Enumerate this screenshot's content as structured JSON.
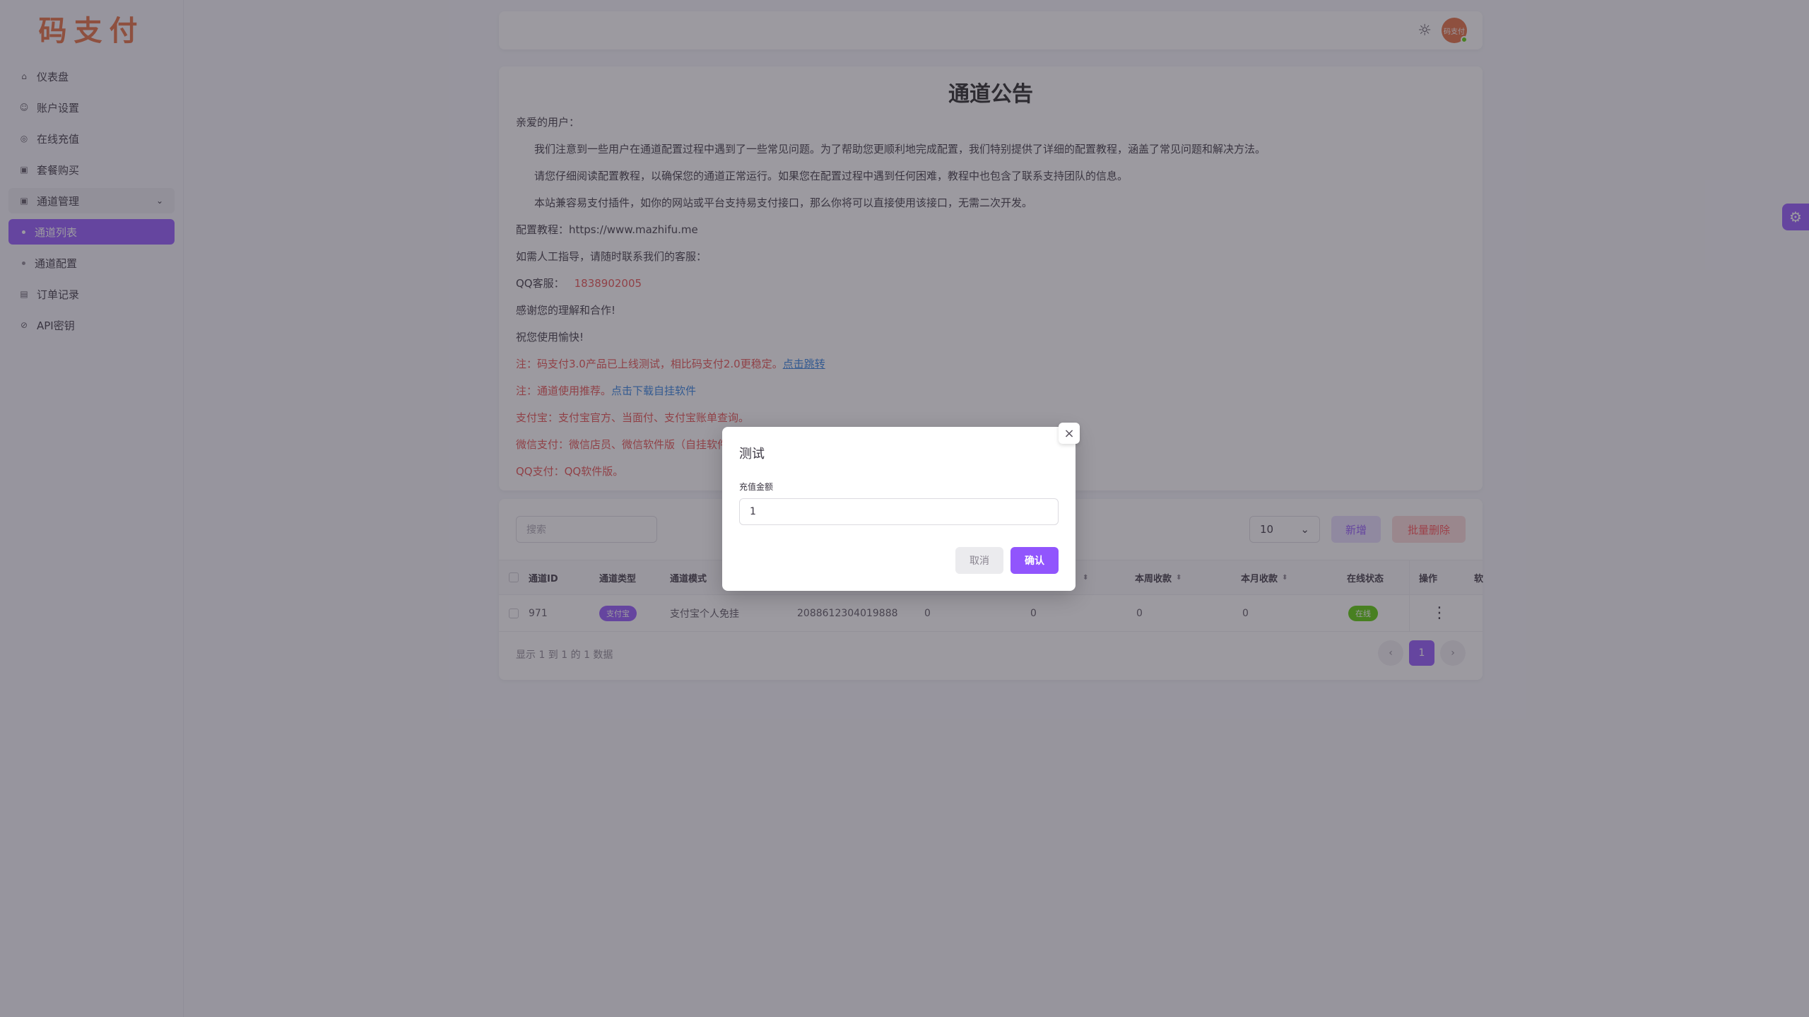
{
  "brand": {
    "logo": "码支付",
    "accent": "#9155fd",
    "logo_color": "#e26a3c"
  },
  "sidebar": {
    "items": [
      {
        "label": "仪表盘",
        "icon": "home-icon"
      },
      {
        "label": "账户设置",
        "icon": "user-icon"
      },
      {
        "label": "在线充值",
        "icon": "coin-icon"
      },
      {
        "label": "套餐购买",
        "icon": "package-icon"
      },
      {
        "label": "通道管理",
        "icon": "channel-icon",
        "expanded": true
      },
      {
        "label": "通道列表",
        "sub": true,
        "active": true
      },
      {
        "label": "通道配置",
        "sub": true
      },
      {
        "label": "订单记录",
        "icon": "order-icon"
      },
      {
        "label": "API密钥",
        "icon": "key-icon"
      }
    ]
  },
  "topbar": {
    "avatar_text": "码支付"
  },
  "notice": {
    "title": "通道公告",
    "greeting": "亲爱的用户：",
    "p1": "我们注意到一些用户在通道配置过程中遇到了一些常见问题。为了帮助您更顺利地完成配置，我们特别提供了详细的配置教程，涵盖了常见问题和解决方法。",
    "p2": "请您仔细阅读配置教程，以确保您的通道正常运行。如果您在配置过程中遇到任何困难，教程中也包含了联系支持团队的信息。",
    "p3": "本站兼容易支付插件，如你的网站或平台支持易支付接口，那么你将可以直接使用该接口，无需二次开发。",
    "tutorial_label": "配置教程：",
    "tutorial_url": "https://www.mazhifu.me",
    "manual": "如需人工指导，请随时联系我们的客服：",
    "qq_label": "QQ客服：",
    "qq_number": "1838902005",
    "thanks": "感谢您的理解和合作!",
    "wish": "祝您使用愉快!",
    "note1": "注：码支付3.0产品已上线测试，相比码支付2.0更稳定。",
    "note1_link": "点击跳转",
    "note2": "注：通道使用推荐。",
    "note2_link": "点击下载自挂软件",
    "alipay": "支付宝：支付宝官方、当面付、支付宝账单查询。",
    "wechat": "微信支付：微信店员、微信软件版（自挂软件）",
    "qqpay": "QQ支付：QQ软件版。"
  },
  "table": {
    "search_placeholder": "搜索",
    "page_size": "10",
    "add_label": "新增",
    "batch_delete_label": "批量删除",
    "columns": [
      "通道ID",
      "通道类型",
      "通道模式",
      "本周收款",
      "本月收款",
      "在线状态",
      "操作",
      "软"
    ],
    "rows": [
      {
        "id": "971",
        "type": "支付宝",
        "mode": "支付宝个人免挂",
        "account": "2088612304019888",
        "v1": "0",
        "v2": "0",
        "week": "0",
        "month": "0",
        "status": "在线"
      }
    ],
    "footer": "显示 1 到 1 的 1 数据",
    "current_page": "1"
  },
  "modal": {
    "title": "测试",
    "field_label": "充值金额",
    "field_value": "1",
    "cancel_label": "取消",
    "confirm_label": "确认"
  }
}
